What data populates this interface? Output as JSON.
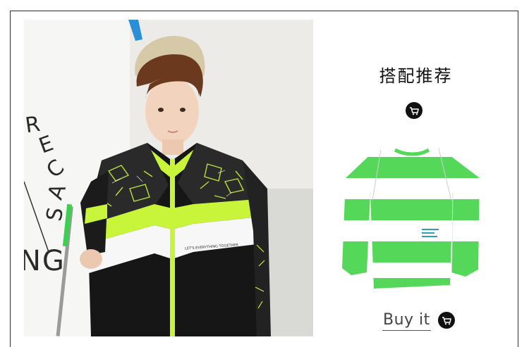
{
  "recommend": {
    "title": "搭配推荐",
    "buy_label": "Buy it"
  },
  "photo": {
    "backdrop_letters": [
      "R",
      "E",
      "C",
      "A",
      "S"
    ],
    "backdrop_bottom": "NG",
    "jacket_print": "LET'S EVERYTHING TOGETHER"
  },
  "icons": {
    "cart_top": "shopping-cart-icon",
    "cart_buy": "shopping-cart-icon"
  },
  "colors": {
    "neon_green": "#c8f53a",
    "shirt_green": "#55d85a",
    "jacket_black": "#161616",
    "frame_border": "#2b2b2b"
  }
}
